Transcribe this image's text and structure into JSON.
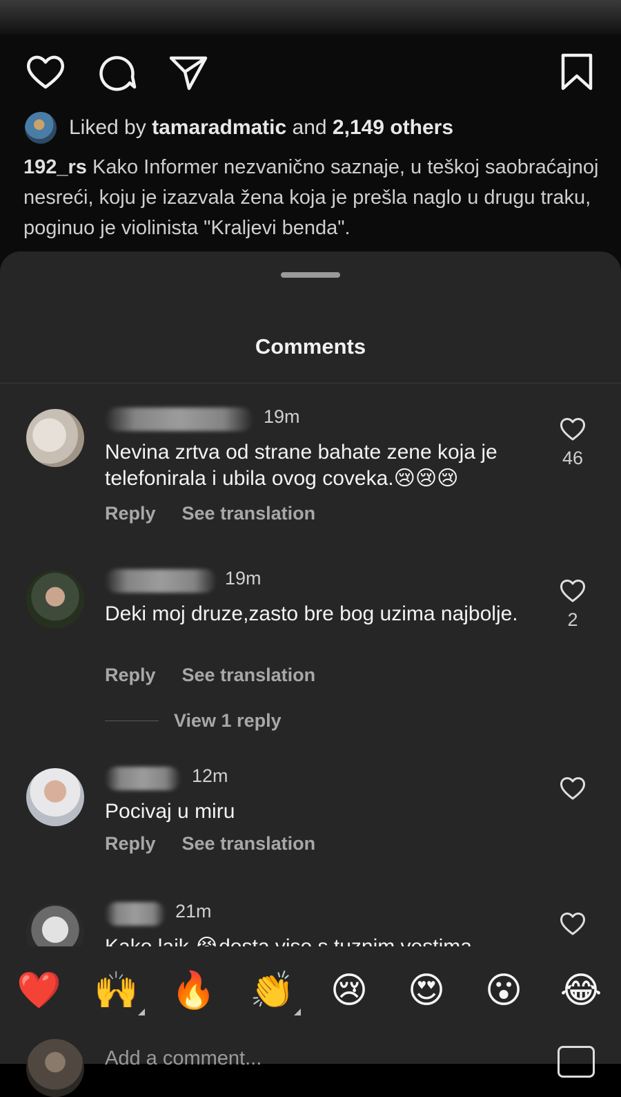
{
  "post": {
    "liked_prefix": "Liked by ",
    "liked_user": "tamaradmatic",
    "liked_and": " and ",
    "liked_others": "2,149 others",
    "caption_user": "192_rs",
    "caption_text": " Kako Informer nezvanično saznaje, u teškoj saobraćajnoj nesreći, koju je izazvala žena koja je prešla naglo u drugu traku, poginuo je violinista \"Kraljevi benda\"."
  },
  "sheet": {
    "title": "Comments"
  },
  "comments": [
    {
      "time": "19m",
      "text": "Nevina zrtva od strane bahate zene koja je telefonirala i ubila ovog coveka.😢😢😢",
      "likes": "46",
      "reply_label": "Reply",
      "translate_label": "See translation"
    },
    {
      "time": "19m",
      "text": "Deki moj druze,zasto bre bog uzima najbolje.",
      "likes": "2",
      "reply_label": "Reply",
      "translate_label": "See translation",
      "view_replies": "View 1 reply"
    },
    {
      "time": "12m",
      "text": "Pocivaj u miru",
      "reply_label": "Reply",
      "translate_label": "See translation"
    },
    {
      "time": "21m",
      "text": "Kako lajk 😭dosta vise s tuznim vestima"
    }
  ],
  "emoji_bar": [
    "❤️",
    "🙌",
    "🔥",
    "👏",
    "😢",
    "😍",
    "😮",
    "😂"
  ],
  "add_comment": {
    "placeholder": "Add a comment..."
  },
  "colors": {
    "background": "#000000",
    "sheet": "#262626",
    "text": "#f5f5f5",
    "muted": "#a8a8a8"
  },
  "icons": {
    "like": "heart-icon",
    "comment": "comment-icon",
    "share": "send-icon",
    "save": "bookmark-icon"
  }
}
